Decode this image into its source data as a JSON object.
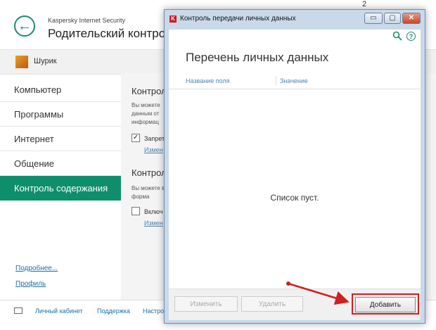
{
  "main": {
    "app_name": "Kaspersky Internet Security",
    "page_title": "Родительский контроль",
    "top_counter": "2",
    "user": {
      "name": "Шурик"
    },
    "sidebar": {
      "items": [
        {
          "label": "Компьютер"
        },
        {
          "label": "Программы"
        },
        {
          "label": "Интернет"
        },
        {
          "label": "Общение"
        },
        {
          "label": "Контроль содержания"
        }
      ],
      "active_item": "Контроль содержания",
      "links": {
        "more": "Подробнее...",
        "profile": "Профиль"
      }
    },
    "content": {
      "section1": {
        "title": "Контрол",
        "text": "Вы можете данным от информац",
        "checkbox_label": "Запрет",
        "checkbox_checked": true,
        "link": "Измен"
      },
      "section2": {
        "title": "Контрол",
        "text": "Вы можете веб-форма",
        "checkbox_label": "Включ",
        "checkbox_checked": false,
        "link": "Измен"
      }
    },
    "footer": {
      "icon": "mail-icon",
      "links": [
        "Личный кабинет",
        "Поддержка",
        "Настро"
      ]
    },
    "accent_color": "#0f8e6c"
  },
  "dialog": {
    "title": "Контроль передачи личных данных",
    "window_buttons": {
      "minimize": "▭",
      "maximize": "▢",
      "close": "✕"
    },
    "heading": "Перечень личных данных",
    "icons": {
      "search": "search-icon",
      "help": "help-icon"
    },
    "help_glyph": "?",
    "columns": {
      "field": "Название поля",
      "value": "Значение"
    },
    "empty_message": "Список пуст.",
    "buttons": {
      "edit": "Изменить",
      "delete": "Удалить",
      "add": "Добавить"
    },
    "highlight_color": "#d01f1f"
  }
}
